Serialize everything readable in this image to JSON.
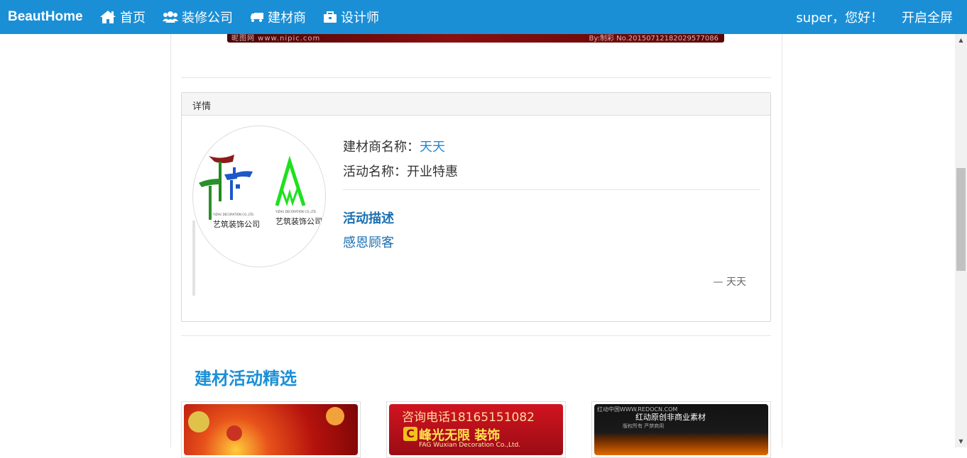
{
  "navbar": {
    "brand": "BeautHome",
    "items": [
      {
        "label": "首页",
        "icon": "home-icon"
      },
      {
        "label": "装修公司",
        "icon": "users-icon"
      },
      {
        "label": "建材商",
        "icon": "truck-icon"
      },
      {
        "label": "设计师",
        "icon": "briefcase-icon"
      }
    ],
    "greeting": "super，您好！",
    "fullscreen": "开启全屏",
    "color": "#1b8fd6"
  },
  "banner": {
    "left_text": "昵图网 www.nipic.com",
    "right_text": "By:制彩 No.20150712182029577086"
  },
  "panel": {
    "heading": "详情",
    "logo": {
      "company_left": "艺筑装饰公司",
      "company_left_en": "YIZHU DECORATION CO.,LTD.",
      "company_right": "艺筑装饰公司",
      "company_right_en": "YIZHU DECORATION CO.,LTD."
    },
    "merchant_label": "建材商名称：",
    "merchant_name": "天天",
    "activity_label": "活动名称：",
    "activity_name": "开业特惠",
    "desc_title": "活动描述",
    "desc_text": "感恩顾客",
    "quote_source": "— 天天"
  },
  "showcase": {
    "title": "建材活动精选",
    "cards": [
      {
        "text": ""
      },
      {
        "line1": "咨询电话18165151082",
        "line2": "峰光无限 装饰",
        "line3": "FAG Wuxian Decoration Co.,Ltd.",
        "mark": "C"
      },
      {
        "line1": "红动中国WWW.REDOCN.COM",
        "line2": "红动原创非商业素材",
        "line3": "版权所有 严禁商用"
      }
    ]
  }
}
